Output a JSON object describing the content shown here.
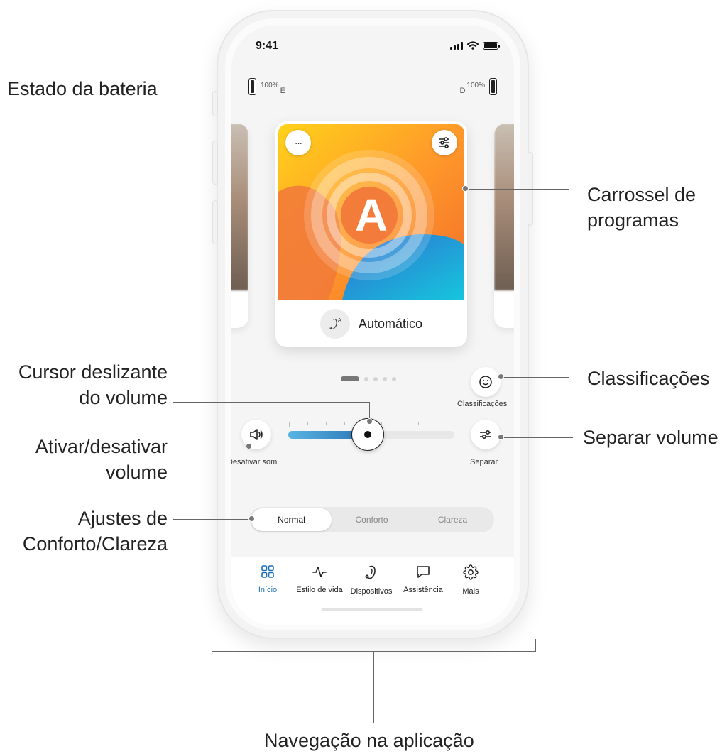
{
  "status_bar": {
    "time": "9:41"
  },
  "battery": {
    "left": {
      "percent": "100%",
      "side": "E"
    },
    "right": {
      "percent": "100%",
      "side": "D"
    }
  },
  "program_card": {
    "letter": "A",
    "name": "Automático",
    "menu_label": "···"
  },
  "carousel": {
    "pages": 5,
    "active_page": 1
  },
  "ratings": {
    "label": "Classificações"
  },
  "mute": {
    "label": "Desativar som"
  },
  "separate": {
    "label": "Separar"
  },
  "volume": {
    "level": 0.48
  },
  "sound_mode": {
    "options": [
      "Normal",
      "Conforto",
      "Clareza"
    ],
    "selected": "Normal"
  },
  "nav": {
    "items": [
      {
        "label": "Início",
        "icon": "grid-icon",
        "active": true
      },
      {
        "label": "Estilo de vida",
        "icon": "activity-icon",
        "active": false
      },
      {
        "label": "Dispositivos",
        "icon": "hearing-aid-icon",
        "active": false
      },
      {
        "label": "Assistência",
        "icon": "chat-icon",
        "active": false
      },
      {
        "label": "Mais",
        "icon": "gear-icon",
        "active": false
      }
    ]
  },
  "callouts": {
    "battery_state": "Estado da bateria",
    "program_carousel_1": "Carrossel de",
    "program_carousel_2": "programas",
    "volume_slider_1": "Cursor deslizante",
    "volume_slider_2": "do volume",
    "ratings": "Classificações",
    "toggle_volume_1": "Ativar/desativar",
    "toggle_volume_2": "volume",
    "separate_volume": "Separar volume",
    "comfort_clarity_1": "Ajustes de",
    "comfort_clarity_2": "Conforto/Clareza",
    "app_navigation": "Navegação na aplicação"
  },
  "colors": {
    "accent": "#1d6fb6",
    "slider_start": "#58b4e3",
    "slider_end": "#2d73b4"
  }
}
